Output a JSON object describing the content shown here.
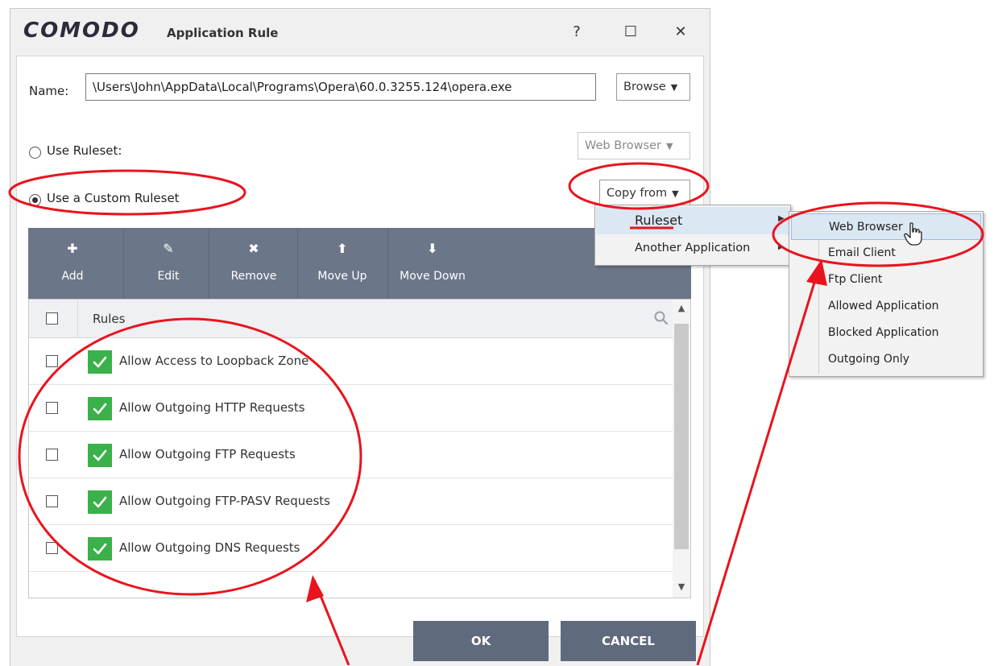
{
  "window": {
    "logo": "COMODO",
    "title": "Application Rule",
    "help_glyph": "?",
    "maximize_glyph": "☐",
    "close_glyph": "✕"
  },
  "name_field": {
    "label": "Name:",
    "value": "\\Users\\John\\AppData\\Local\\Programs\\Opera\\60.0.3255.124\\opera.exe",
    "browse_label": "Browse"
  },
  "options": {
    "use_ruleset_label": "Use Ruleset:",
    "use_ruleset_selected": false,
    "ruleset_value": "Web Browser",
    "use_custom_label": "Use a Custom Ruleset",
    "use_custom_selected": true,
    "copy_from_label": "Copy from"
  },
  "toolbar": {
    "buttons": [
      {
        "label": "Add",
        "icon": "plus-icon",
        "glyph": "✚"
      },
      {
        "label": "Edit",
        "icon": "pencil-icon",
        "glyph": "✎"
      },
      {
        "label": "Remove",
        "icon": "x-icon",
        "glyph": "✖"
      },
      {
        "label": "Move Up",
        "icon": "arrow-up-icon",
        "glyph": "⬆"
      },
      {
        "label": "Move Down",
        "icon": "arrow-down-icon",
        "glyph": "⬇"
      }
    ]
  },
  "rules_table": {
    "column_header": "Rules",
    "rows": [
      {
        "label": "Allow Access to Loopback Zone",
        "selected": false,
        "enabled": true
      },
      {
        "label": "Allow Outgoing HTTP Requests",
        "selected": false,
        "enabled": true
      },
      {
        "label": "Allow Outgoing FTP Requests",
        "selected": false,
        "enabled": true
      },
      {
        "label": "Allow Outgoing FTP-PASV Requests",
        "selected": false,
        "enabled": true
      },
      {
        "label": "Allow Outgoing DNS Requests",
        "selected": false,
        "enabled": true
      }
    ]
  },
  "buttons": {
    "ok_label": "OK",
    "cancel_label": "CANCEL"
  },
  "copy_menu": {
    "items": [
      {
        "label": "Ruleset",
        "highlighted": true
      },
      {
        "label": "Another Application",
        "highlighted": false
      }
    ]
  },
  "ruleset_submenu": {
    "items": [
      {
        "label": "Web Browser",
        "highlighted": true
      },
      {
        "label": "Email Client",
        "highlighted": false
      },
      {
        "label": "Ftp Client",
        "highlighted": false
      },
      {
        "label": "Allowed Application",
        "highlighted": false
      },
      {
        "label": "Blocked Application",
        "highlighted": false
      },
      {
        "label": "Outgoing Only",
        "highlighted": false
      }
    ]
  },
  "colors": {
    "toolbar_bg": "#6c7689",
    "button_bg": "#5f6a7d",
    "check_green": "#3ab14a",
    "annotation_red": "#e8141e",
    "menu_highlight": "#dce7f4"
  }
}
